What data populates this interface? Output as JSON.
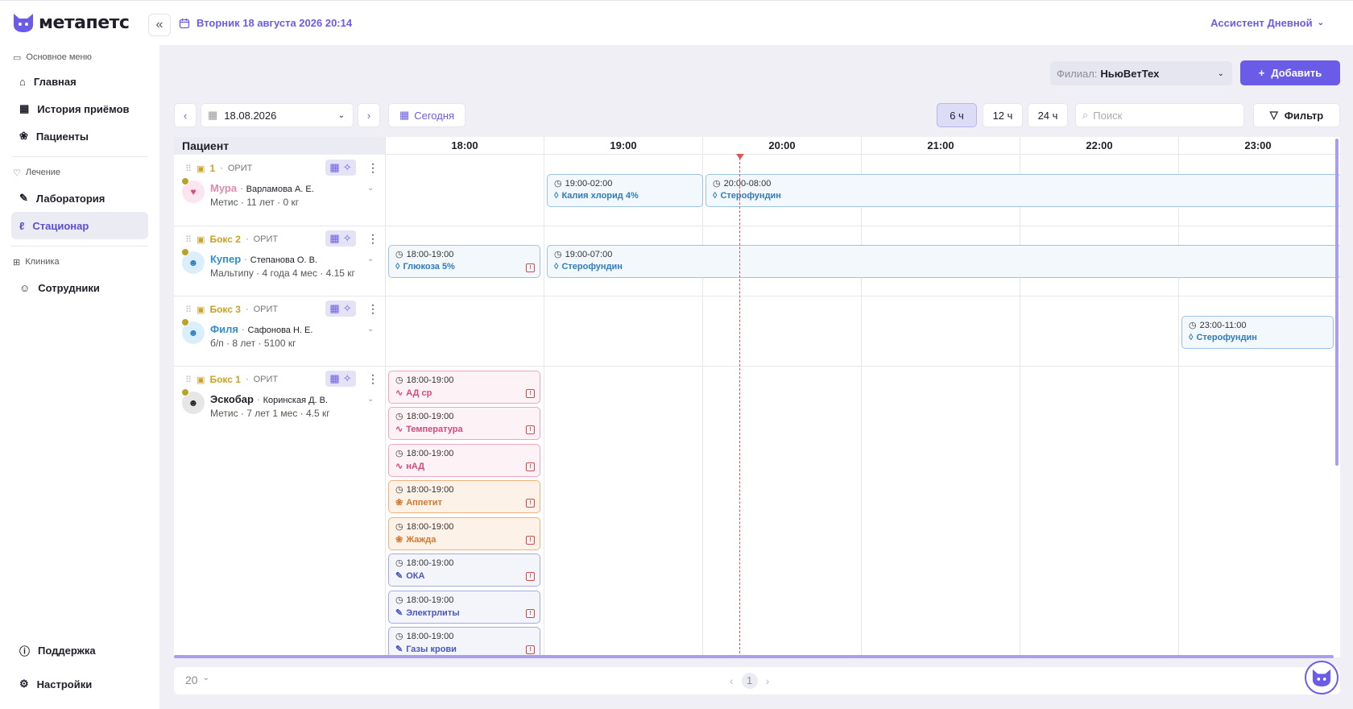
{
  "app": {
    "logo_text": "метапетс"
  },
  "topbar": {
    "datetime": "Вторник 18 августа 2026 20:14",
    "user": "Ассистент Дневной"
  },
  "sidebar": {
    "section_main": "Основное меню",
    "item_home": "Главная",
    "item_history": "История приёмов",
    "item_patients": "Пациенты",
    "section_treatment": "Лечение",
    "item_lab": "Лаборатория",
    "item_hospital": "Стационар",
    "section_clinic": "Клиника",
    "item_staff": "Сотрудники",
    "item_support": "Поддержка",
    "item_settings": "Настройки"
  },
  "toolbar": {
    "filial_label": "Филиал:",
    "filial_value": "НьюВетТех",
    "add_label": "Добавить",
    "date_value": "18.08.2026",
    "today_label": "Сегодня",
    "range_6": "6 ч",
    "range_12": "12 ч",
    "range_24": "24 ч",
    "search_placeholder": "Поиск",
    "filter_label": "Фильтр"
  },
  "grid": {
    "patient_header": "Пациент",
    "hours": [
      "18:00",
      "19:00",
      "20:00",
      "21:00",
      "22:00",
      "23:00"
    ]
  },
  "patients": [
    {
      "box": "1",
      "dept": "ОРИТ",
      "name": "Мура",
      "owner": "Варламова А. Е.",
      "meta": "Метис · 11 лет · 0 кг"
    },
    {
      "box": "Бокс 2",
      "dept": "ОРИТ",
      "name": "Купер",
      "owner": "Степанова О. В.",
      "meta": "Мальтипу · 4 года 4 мес · 4.15 кг"
    },
    {
      "box": "Бокс 3",
      "dept": "ОРИТ",
      "name": "Филя",
      "owner": "Сафонова Н. Е.",
      "meta": "б/п · 8 лет · 5100 кг"
    },
    {
      "box": "Бокс 1",
      "dept": "ОРИТ",
      "name": "Эскобар",
      "owner": "Коринская Д. В.",
      "meta": "Метис · 7 лет 1 мес · 4.5 кг"
    }
  ],
  "cards": [
    {
      "time": "19:00-02:00",
      "name": "Калия хлорид 4%"
    },
    {
      "time": "20:00-08:00",
      "name": "Стерофундин"
    },
    {
      "time": "18:00-19:00",
      "name": "Глюкоза 5%"
    },
    {
      "time": "19:00-07:00",
      "name": "Стерофундин"
    },
    {
      "time": "23:00-11:00",
      "name": "Стерофундин"
    },
    {
      "time": "18:00-19:00",
      "name": "АД ср"
    },
    {
      "time": "18:00-19:00",
      "name": "Температура"
    },
    {
      "time": "18:00-19:00",
      "name": "нАД"
    },
    {
      "time": "18:00-19:00",
      "name": "Аппетит"
    },
    {
      "time": "18:00-19:00",
      "name": "Жажда"
    },
    {
      "time": "18:00-19:00",
      "name": "ОКА"
    },
    {
      "time": "18:00-19:00",
      "name": "Электрлиты"
    },
    {
      "time": "18:00-19:00",
      "name": "Газы крови"
    }
  ],
  "footer": {
    "page_size": "20",
    "page": "1"
  },
  "current_time_marker": "20:14"
}
